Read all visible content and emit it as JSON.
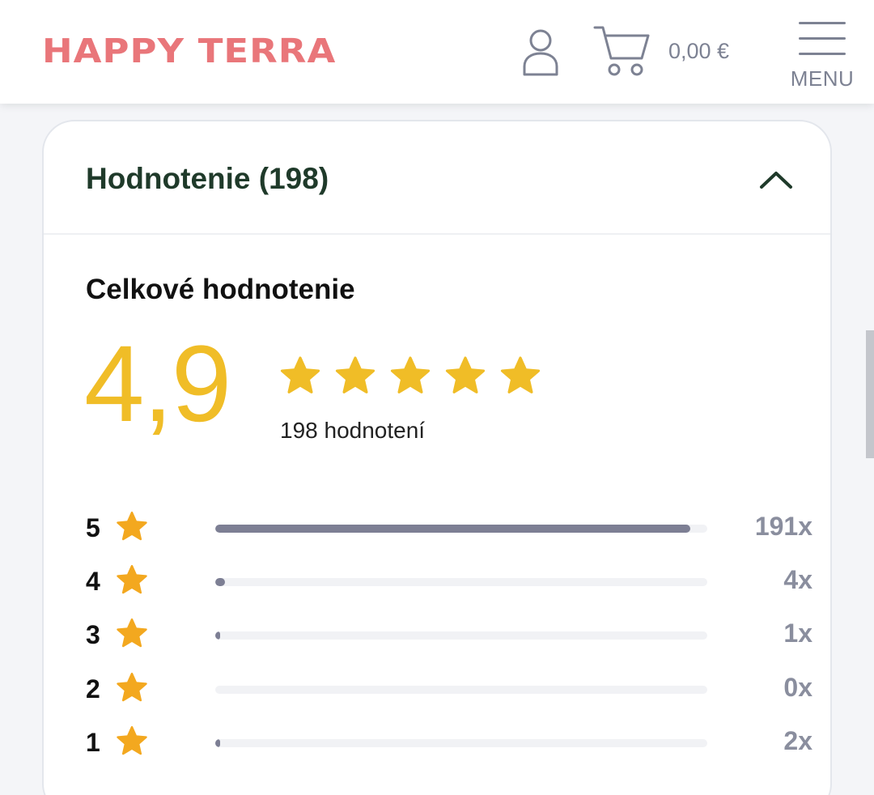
{
  "header": {
    "logo_text": "HAPPY TERRA",
    "user_icon": "user-icon",
    "cart_icon": "cart-icon",
    "cart_total": "0,00 €",
    "menu_label": "MENU",
    "colors": {
      "logo": "#e9767a",
      "icons": "#7d8293"
    }
  },
  "reviews": {
    "section_title": "Hodnotenie (198)",
    "toggle_icon": "chevron-up-icon",
    "overall_title": "Celkové hodnotenie",
    "score": "4,9",
    "stars_filled": 5,
    "review_count_text": "198 hodnotení",
    "total": 198,
    "distribution": [
      {
        "stars": "5",
        "count": 191,
        "count_label": "191x"
      },
      {
        "stars": "4",
        "count": 4,
        "count_label": "4x"
      },
      {
        "stars": "3",
        "count": 1,
        "count_label": "1x"
      },
      {
        "stars": "2",
        "count": 0,
        "count_label": "0x"
      },
      {
        "stars": "1",
        "count": 2,
        "count_label": "2x"
      }
    ],
    "colors": {
      "score": "#f0bd27",
      "star": "#f3a81f",
      "bar": "#7d7f94",
      "title": "#1f3a2a"
    }
  }
}
